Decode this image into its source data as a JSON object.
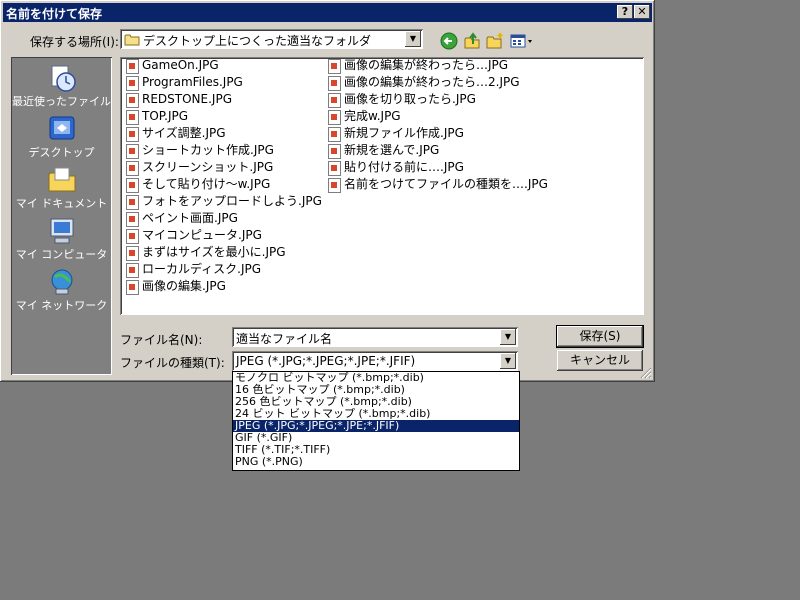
{
  "window": {
    "title": "名前を付けて保存",
    "help_label": "?",
    "close_label": "✕"
  },
  "location": {
    "label": "保存する場所(I):",
    "value": "デスクトップ上につくった適当なフォルダ"
  },
  "toolbar": {
    "back_icon": "back-arrow-icon",
    "up_icon": "up-folder-icon",
    "new_folder_icon": "new-folder-icon",
    "view_icon": "view-menu-icon"
  },
  "places": [
    {
      "label": "最近使ったファイル",
      "icon": "recent-files-icon"
    },
    {
      "label": "デスクトップ",
      "icon": "desktop-icon"
    },
    {
      "label": "マイ ドキュメント",
      "icon": "my-documents-icon"
    },
    {
      "label": "マイ コンピュータ",
      "icon": "my-computer-icon"
    },
    {
      "label": "マイ ネットワーク",
      "icon": "my-network-icon"
    }
  ],
  "files_col1": [
    "GameOn.JPG",
    "ProgramFiles.JPG",
    "REDSTONE.JPG",
    "TOP.JPG",
    "サイズ調整.JPG",
    "ショートカット作成.JPG",
    "スクリーンショット.JPG",
    "そして貼り付け〜w.JPG",
    "フォトをアップロードしよう.JPG",
    "ペイント画面.JPG",
    "マイコンピュータ.JPG",
    "まずはサイズを最小に.JPG",
    "ローカルディスク.JPG",
    "画像の編集.JPG"
  ],
  "files_col2": [
    "画像の編集が終わったら…JPG",
    "画像の編集が終わったら…2.JPG",
    "画像を切り取ったら.JPG",
    "完成w.JPG",
    "新規ファイル作成.JPG",
    "新規を選んで.JPG",
    "貼り付ける前に….JPG",
    "名前をつけてファイルの種類を….JPG"
  ],
  "filename": {
    "label": "ファイル名(N):",
    "value": "適当なファイル名"
  },
  "filetype": {
    "label": "ファイルの種類(T):",
    "value": "JPEG (*.JPG;*.JPEG;*.JPE;*.JFIF)",
    "options": [
      "モノクロ ビットマップ (*.bmp;*.dib)",
      "16 色ビットマップ (*.bmp;*.dib)",
      "256 色ビットマップ (*.bmp;*.dib)",
      "24 ビット ビットマップ (*.bmp;*.dib)",
      "JPEG (*.JPG;*.JPEG;*.JPE;*.JFIF)",
      "GIF (*.GIF)",
      "TIFF (*.TIF;*.TIFF)",
      "PNG (*.PNG)"
    ],
    "selected_index": 4
  },
  "buttons": {
    "save": "保存(S)",
    "cancel": "キャンセル"
  },
  "colors": {
    "titlebar": "#0a246a",
    "dialog_face": "#d4d0c8",
    "desktop": "#7b7b7b",
    "selection": "#0a246a"
  }
}
